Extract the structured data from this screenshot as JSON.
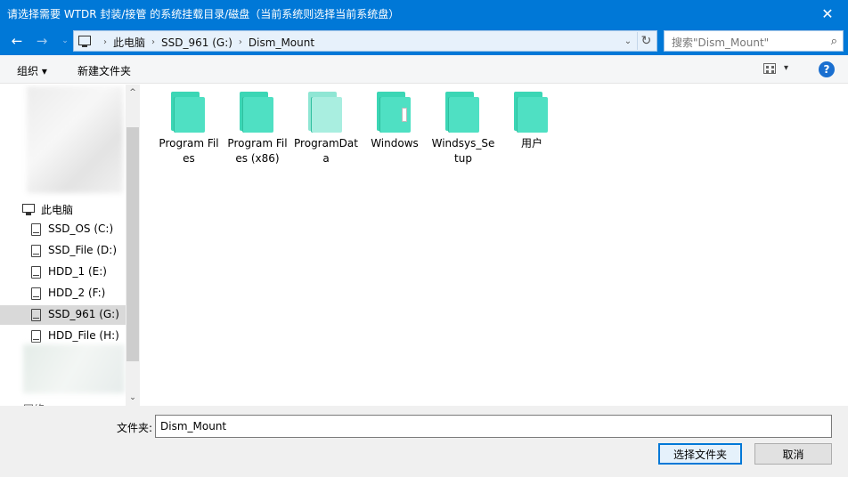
{
  "window": {
    "title": "请选择需要 WTDR 封装/接管 的系统挂载目录/磁盘（当前系统则选择当前系统盘）",
    "close_glyph": "✕"
  },
  "nav": {
    "back_glyph": "←",
    "forward_glyph": "→",
    "recent_glyph": "⌄",
    "breadcrumbs": [
      "此电脑",
      "SSD_961 (G:)",
      "Dism_Mount"
    ],
    "sep_glyph": "›",
    "dropdown_glyph": "⌄",
    "refresh_glyph": "↻",
    "search_placeholder": "搜索\"Dism_Mount\"",
    "search_glyph": "⌕"
  },
  "toolbar": {
    "organize": "组织 ▾",
    "new_folder": "新建文件夹",
    "view_dropdown": "▾",
    "help": "?"
  },
  "sidebar": {
    "this_pc": "此电脑",
    "drives": [
      {
        "label": "SSD_OS (C:)",
        "selected": false
      },
      {
        "label": "SSD_File (D:)",
        "selected": false
      },
      {
        "label": "HDD_1 (E:)",
        "selected": false
      },
      {
        "label": "HDD_2 (F:)",
        "selected": false
      },
      {
        "label": "SSD_961 (G:)",
        "selected": true
      },
      {
        "label": "HDD_File (H:)",
        "selected": false
      }
    ],
    "partial_item": "网络",
    "scroll_up": "^",
    "scroll_down": "⌄"
  },
  "folders": [
    {
      "name": "Program Files",
      "icon": "folder-icon",
      "style": "normal"
    },
    {
      "name": "Program Files (x86)",
      "icon": "folder-icon",
      "style": "normal"
    },
    {
      "name": "ProgramData",
      "icon": "folder-icon",
      "style": "light"
    },
    {
      "name": "Windows",
      "icon": "folder-icon",
      "style": "paper"
    },
    {
      "name": "Windsys_Setup",
      "icon": "folder-icon",
      "style": "normal"
    },
    {
      "name": "用户",
      "icon": "folder-icon",
      "style": "normal"
    }
  ],
  "footer": {
    "folder_label": "文件夹:",
    "folder_value": "Dism_Mount",
    "select_button": "选择文件夹",
    "cancel_button": "取消"
  },
  "colors": {
    "titlebar": "#0078d7",
    "folder": "#4fe0c3",
    "selection": "#d9d9d9"
  }
}
